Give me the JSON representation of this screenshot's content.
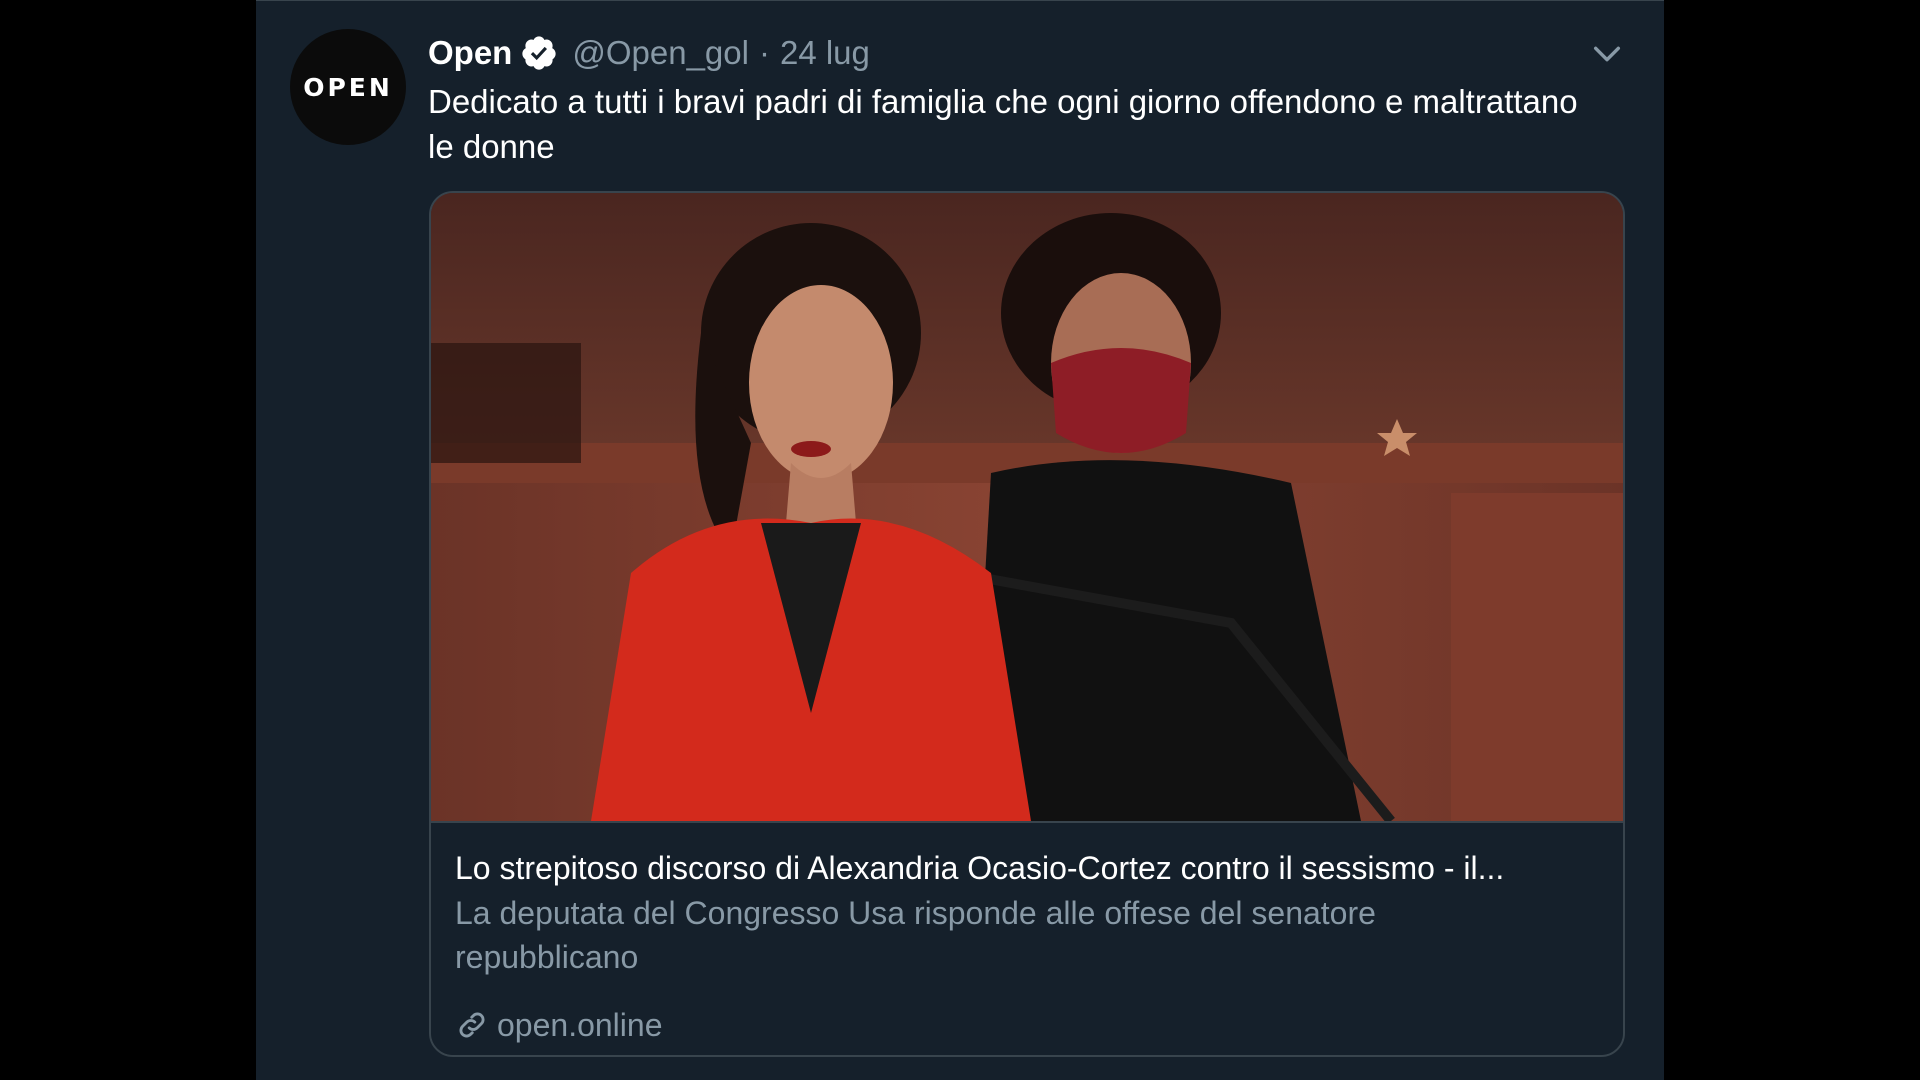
{
  "tweet": {
    "avatar_text": "OPEN",
    "author_name": "Open",
    "handle": "@Open_gol",
    "separator": "·",
    "date": "24 lug",
    "text": "Dedicato a tutti i bravi padri di famiglia che ogni giorno offendono e maltrattano le donne",
    "icons": {
      "verified": "verified-badge-icon",
      "menu": "chevron-down-icon",
      "link": "link-icon"
    }
  },
  "card": {
    "title": "Lo strepitoso discorso di Alexandria Ocasio-Cortez contro il sessismo - il...",
    "description": "La deputata del Congresso Usa risponde alle offese del senatore repubblicano",
    "domain": "open.online"
  },
  "colors": {
    "background": "#15202b",
    "outer": "#000000",
    "text": "#ffffff",
    "secondary": "#8899a6",
    "border": "#38444d",
    "verified": "#ffffff"
  }
}
